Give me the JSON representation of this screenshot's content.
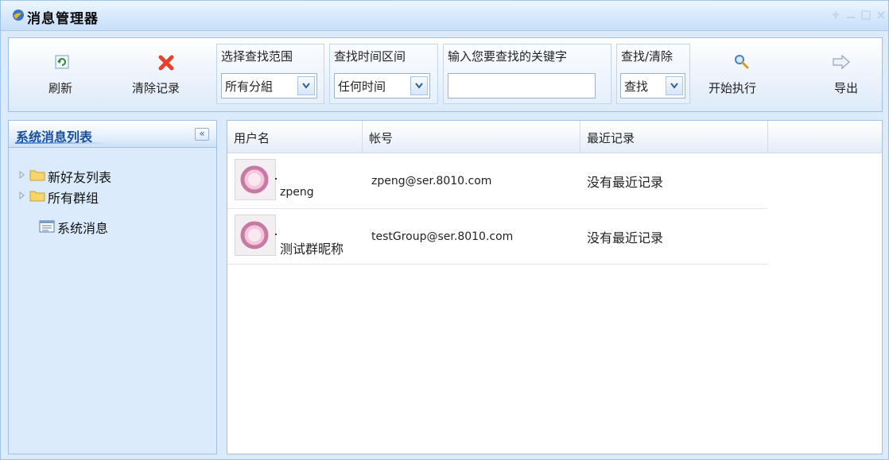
{
  "window": {
    "title": "消息管理器"
  },
  "toolbar": {
    "refresh_label": "刷新",
    "clear_label": "清除记录",
    "scope": {
      "label": "选择查找范围",
      "value": "所有分組"
    },
    "time": {
      "label": "查找时间区间",
      "value": "任何时间"
    },
    "keyword": {
      "label": "输入您要查找的关键字",
      "value": "",
      "placeholder": ""
    },
    "mode": {
      "label": "查找/清除",
      "value": "查找"
    },
    "execute_label": "开始执行",
    "export_label": "导出"
  },
  "sidebar": {
    "title": "系统消息列表",
    "collapse_symbol": "«",
    "items": [
      {
        "label": "新好友列表",
        "icon": "folder-icon"
      },
      {
        "label": "所有群组",
        "icon": "folder-icon"
      },
      {
        "label": "系统消息",
        "icon": "message-list-icon"
      }
    ]
  },
  "grid": {
    "columns": [
      "用户名",
      "帐号",
      "最近记录"
    ],
    "rows": [
      {
        "username": "zpeng",
        "account": "zpeng@ser.8010.com",
        "recent": "没有最近记录"
      },
      {
        "username": "测试群昵称",
        "account": "testGroup@ser.8010.com",
        "recent": "没有最近记录"
      }
    ]
  },
  "colors": {
    "window_bg": "#dcebfb",
    "border": "#9fc1e6",
    "sidebar_title": "#1b4f9c",
    "clear_icon": "#e8412b"
  }
}
